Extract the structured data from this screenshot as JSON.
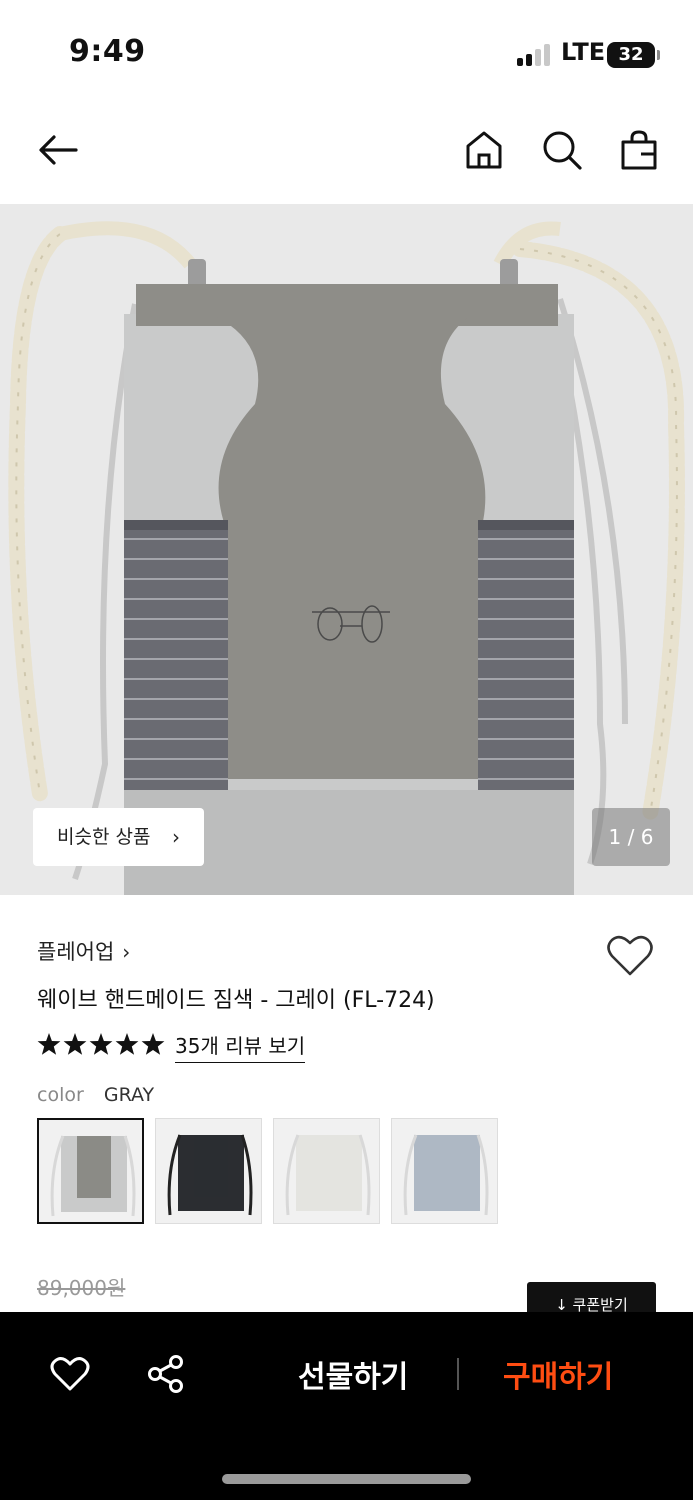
{
  "status_bar": {
    "time": "9:49",
    "network": "LTE",
    "battery": "32"
  },
  "nav": {
    "back_icon": "arrow-left-icon",
    "home_icon": "home-icon",
    "search_icon": "search-icon",
    "cart_icon": "shopping-bag-icon"
  },
  "gallery": {
    "similar_label": "비슷한 상품",
    "chevron": "›",
    "counter": "1 / 6"
  },
  "product": {
    "brand": "플레어업",
    "brand_chevron": "›",
    "title": "웨이브 핸드메이드 짐색 - 그레이 (FL-724)",
    "rating": 5,
    "review_link": "35개 리뷰 보기",
    "color_label": "color",
    "color_value": "GRAY",
    "swatch_colors": [
      "#8b8b86",
      "#2b2d31",
      "#e4e4e0",
      "#aeb8c4"
    ],
    "original_price": "89,000원",
    "coupon_label": "↓ 쿠폰받기"
  },
  "bottom_bar": {
    "wishlist_icon": "heart-outline-icon",
    "share_icon": "share-icon",
    "gift_label": "선물하기",
    "buy_label": "구매하기",
    "buy_color": "#ff4d12"
  }
}
